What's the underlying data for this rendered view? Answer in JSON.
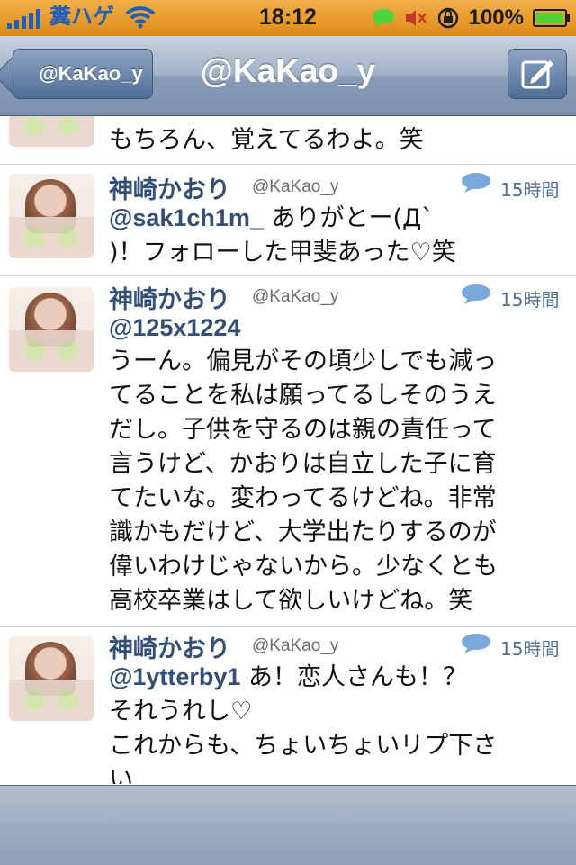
{
  "status_bar": {
    "carrier": "糞ハゲ",
    "time": "18:12",
    "battery": "100%",
    "signal_bars": 5,
    "icons": [
      "signal-icon",
      "wifi-icon",
      "chat-icon",
      "mute-icon",
      "rotation-lock-icon",
      "battery-icon"
    ]
  },
  "nav": {
    "back_label": "@KaKao_y",
    "title": "@KaKao_y",
    "compose_icon": "compose-icon"
  },
  "tweets": [
    {
      "name": "",
      "handle": "",
      "time": "",
      "text": "もちろん、覚えてるわよ。笑"
    },
    {
      "name": "神崎かおり",
      "handle": "@KaKao_y",
      "time": "15時間",
      "mention": "@sak1ch1m_",
      "text_line1": " ありがとー(Д`",
      "text_line2": ")！フォローした甲斐あった♡笑"
    },
    {
      "name": "神崎かおり",
      "handle": "@KaKao_y",
      "time": "15時間",
      "mention": "@125x1224",
      "lines": [
        "うーん。偏見がその頃少しでも減っ",
        "てることを私は願ってるしそのうえ",
        "だし。子供を守るのは親の責任って",
        "言うけど、かおりは自立した子に育",
        "てたいな。変わってるけどね。非常",
        "識かもだけど、大学出たりするのが",
        "偉いわけじゃないから。少なくとも",
        "高校卒業はして欲しいけどね。笑"
      ]
    },
    {
      "name": "神崎かおり",
      "handle": "@KaKao_y",
      "time": "15時間",
      "mention": "@1ytterby1",
      "text_line1": " あ！恋人さんも！？",
      "lines": [
        "それうれし♡",
        "これからも、ちょいちょいリプ下さ",
        "い"
      ]
    }
  ]
}
